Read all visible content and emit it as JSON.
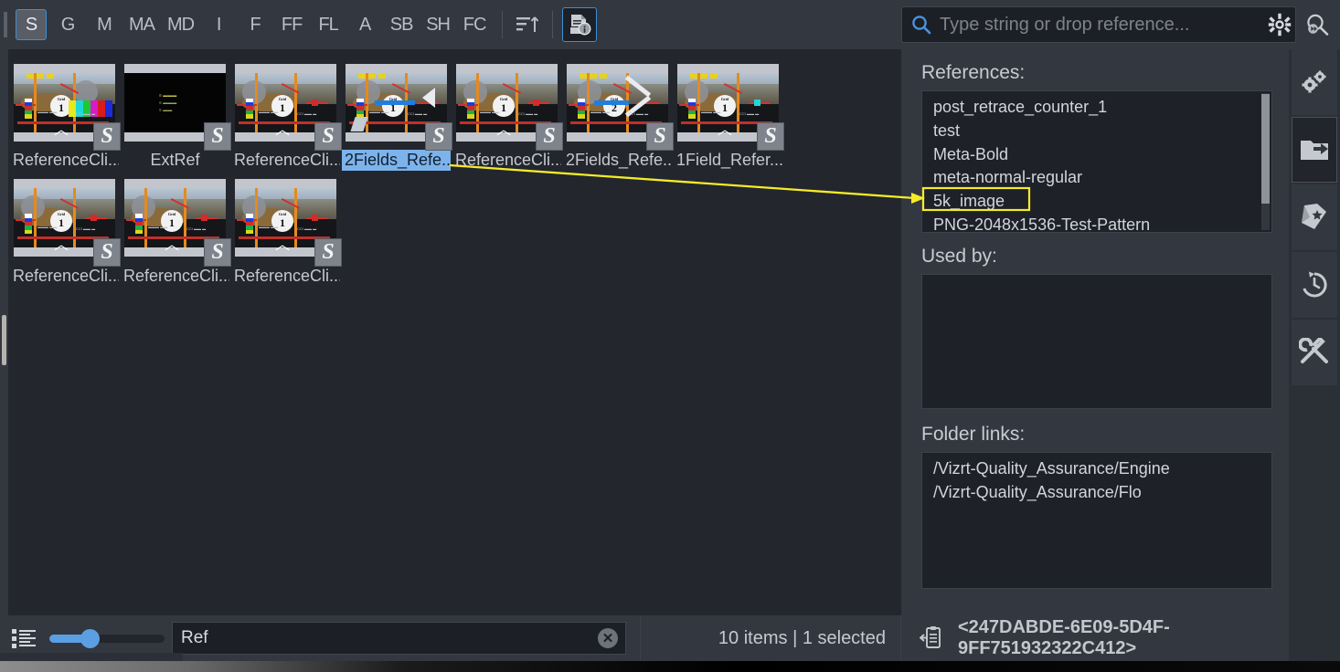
{
  "toolbar": {
    "tabs": [
      {
        "label": "S",
        "name": "tab-s",
        "active": true
      },
      {
        "label": "G",
        "name": "tab-g",
        "active": false
      },
      {
        "label": "M",
        "name": "tab-m",
        "active": false
      },
      {
        "label": "MA",
        "name": "tab-ma",
        "active": false
      },
      {
        "label": "MD",
        "name": "tab-md",
        "active": false
      },
      {
        "label": "I",
        "name": "tab-i",
        "active": false
      },
      {
        "label": "F",
        "name": "tab-f",
        "active": false
      },
      {
        "label": "FF",
        "name": "tab-ff",
        "active": false
      },
      {
        "label": "FL",
        "name": "tab-fl",
        "active": false
      },
      {
        "label": "A",
        "name": "tab-a",
        "active": false
      },
      {
        "label": "SB",
        "name": "tab-sb",
        "active": false
      },
      {
        "label": "SH",
        "name": "tab-sh",
        "active": false
      },
      {
        "label": "FC",
        "name": "tab-fc",
        "active": false
      }
    ],
    "sort_icon": "sort-ascending-icon",
    "info_icon": "document-info-icon",
    "accent_color": "#3d8fd6"
  },
  "search": {
    "icon": "search-icon",
    "placeholder": "Type string or drop reference...",
    "value": "",
    "gear_icon": "gear-icon",
    "advanced_icon": "advanced-search-icon"
  },
  "browser": {
    "items": [
      {
        "label": "ReferenceCli...",
        "badge": "S",
        "selected": false,
        "style": "colorbars"
      },
      {
        "label": "ExtRef",
        "badge": "S",
        "selected": false,
        "style": "black"
      },
      {
        "label": "ReferenceCli...",
        "badge": "S",
        "selected": false,
        "style": "scene"
      },
      {
        "label": "2Fields_Refe...",
        "badge": "S",
        "selected": true,
        "style": "fields"
      },
      {
        "label": "ReferenceCli...",
        "badge": "S",
        "selected": false,
        "style": "scene"
      },
      {
        "label": "2Fields_Refe...",
        "badge": "S",
        "selected": false,
        "style": "fields2"
      },
      {
        "label": "1Field_Refer...",
        "badge": "S",
        "selected": false,
        "style": "scene2"
      },
      {
        "label": "ReferenceCli...",
        "badge": "S",
        "selected": false,
        "style": "scene"
      },
      {
        "label": "ReferenceCli...",
        "badge": "S",
        "selected": false,
        "style": "scene"
      },
      {
        "label": "ReferenceCli...",
        "badge": "S",
        "selected": false,
        "style": "scene"
      }
    ],
    "selection_color": "#7cb3ec"
  },
  "statusbar": {
    "listview_icon": "list-view-icon",
    "zoom_slider_value": 33,
    "filter_value": "Ref",
    "filter_clear_icon": "clear-x-icon",
    "count_text": "10 items | 1 selected"
  },
  "inspector": {
    "references_label": "References:",
    "references": [
      "post_retrace_counter_1",
      "test",
      "Meta-Bold",
      "meta-normal-regular",
      "5k_image",
      "PNG-2048x1536-Test-Pattern"
    ],
    "highlighted_reference": "5k_image",
    "used_by_label": "Used by:",
    "used_by": [],
    "folder_links_label": "Folder links:",
    "folder_links": [
      "/Vizrt-Quality_Assurance/Engine",
      "/Vizrt-Quality_Assurance/Flo"
    ]
  },
  "uuid_bar": {
    "icon": "paste-clipboard-icon",
    "value": "<247DABDE-6E09-5D4F-9FF751932322C412>"
  },
  "rail": {
    "items": [
      {
        "name": "plugins-gears-icon",
        "active": false
      },
      {
        "name": "folder-share-icon",
        "active": true
      },
      {
        "name": "bookmark-star-icon",
        "active": false
      },
      {
        "name": "history-clock-icon",
        "active": false
      },
      {
        "name": "tools-icon",
        "active": false
      }
    ]
  },
  "annotation": {
    "color": "#f5eb2a",
    "arrow_target": "5k_image",
    "arrow_source": "2Fields_Refe..."
  }
}
